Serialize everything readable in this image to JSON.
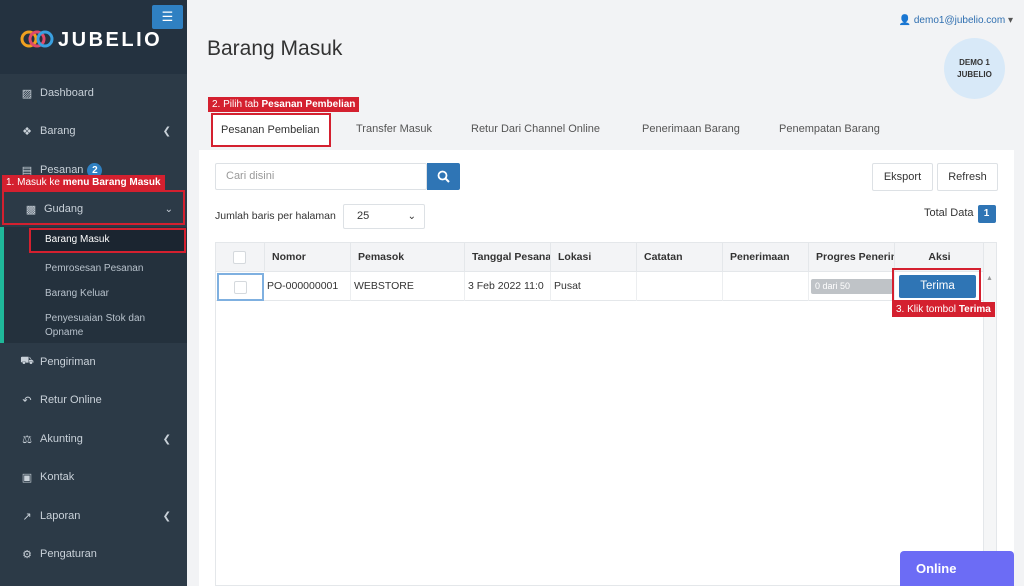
{
  "brand": {
    "name": "JUBELIO",
    "menu_icon": "hamburger-icon"
  },
  "sidebar": {
    "items": [
      {
        "label": "Dashboard",
        "icon": "chart-icon"
      },
      {
        "label": "Barang",
        "icon": "cubes-icon"
      },
      {
        "label": "Pesanan",
        "icon": "basket-icon",
        "badge": "2"
      },
      {
        "label": "Gudang",
        "icon": "building-icon"
      },
      {
        "label": "Pengiriman",
        "icon": "truck-icon"
      },
      {
        "label": "Retur Online",
        "icon": "return-icon"
      },
      {
        "label": "Akunting",
        "icon": "scale-icon"
      },
      {
        "label": "Kontak",
        "icon": "contact-card-icon"
      },
      {
        "label": "Laporan",
        "icon": "line-chart-icon"
      },
      {
        "label": "Pengaturan",
        "icon": "gears-icon"
      }
    ],
    "submenu": {
      "barang_masuk": "Barang Masuk",
      "pemrosesan": "Pemrosesan Pesanan",
      "barang_keluar": "Barang Keluar",
      "penyesuaian_1": "Penyesuaian Stok dan",
      "penyesuaian_2": "Opname"
    }
  },
  "callouts": {
    "step1_prefix": "1. Masuk ke ",
    "step1_bold": "menu Barang Masuk",
    "step2_prefix": "2. Pilih tab ",
    "step2_bold": "Pesanan Pembelian",
    "step3_prefix": "3. Klik tombol ",
    "step3_bold": "Terima",
    "color": "#d4202f"
  },
  "header": {
    "title": "Barang Masuk",
    "user_email": "demo1@jubelio.com",
    "avatar_line1": "DEMO 1",
    "avatar_line2": "JUBELIO"
  },
  "tabs": [
    "Pesanan Pembelian",
    "Transfer Masuk",
    "Retur Dari Channel Online",
    "Penerimaan Barang",
    "Penempatan Barang"
  ],
  "toolbar": {
    "search_placeholder": "Cari disini",
    "export_label": "Eksport",
    "refresh_label": "Refresh",
    "rows_label": "Jumlah baris per halaman",
    "rows_value": "25",
    "total_label": "Total Data",
    "total_value": "1"
  },
  "table": {
    "columns": [
      "Nomor",
      "Pemasok",
      "Tanggal Pesanan",
      "Lokasi",
      "Catatan",
      "Penerimaan",
      "Progres Penerimaan",
      "Aksi"
    ],
    "rows": [
      {
        "nomor": "PO-000000001",
        "pemasok": "WEBSTORE",
        "tanggal": "3 Feb 2022 11:0",
        "lokasi": "Pusat",
        "catatan": "",
        "penerimaan": "",
        "progres": "0 dari 50",
        "progress_fraction": 0,
        "aksi": "Terima"
      }
    ]
  },
  "chat": {
    "label": "Online"
  },
  "colors": {
    "sidebar": "#2c3a47",
    "primary": "#2f75b5",
    "accent": "#1fb89a",
    "chat": "#6c6cf5"
  }
}
